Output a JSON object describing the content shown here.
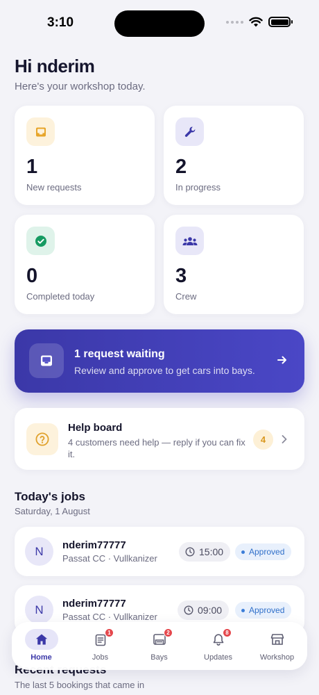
{
  "status_bar": {
    "time": "3:10"
  },
  "header": {
    "greeting": "Hi nderim",
    "subtitle": "Here's your workshop today."
  },
  "stats": [
    {
      "value": "1",
      "label": "New requests",
      "icon": "inbox-icon"
    },
    {
      "value": "2",
      "label": "In progress",
      "icon": "wrench-icon"
    },
    {
      "value": "0",
      "label": "Completed today",
      "icon": "check-circle-icon"
    },
    {
      "value": "3",
      "label": "Crew",
      "icon": "group-icon"
    }
  ],
  "banner": {
    "title": "1 request waiting",
    "text": "Review and approve to get cars into bays."
  },
  "help_board": {
    "title": "Help board",
    "text": "4 customers need help — reply if you can fix it.",
    "count": "4"
  },
  "todays_jobs": {
    "title": "Today's jobs",
    "date": "Saturday, 1 August",
    "items": [
      {
        "initial": "N",
        "name": "nderim77777",
        "car": "Passat CC · Vullkanizer",
        "time": "15:00",
        "status": "Approved"
      },
      {
        "initial": "N",
        "name": "nderim77777",
        "car": "Passat CC · Vullkanizer",
        "time": "09:00",
        "status": "Approved"
      }
    ]
  },
  "recent_requests": {
    "title": "Recent requests",
    "subtitle": "The last 5 bookings that came in"
  },
  "tabbar": [
    {
      "label": "Home",
      "active": true
    },
    {
      "label": "Jobs",
      "badge": "1"
    },
    {
      "label": "Bays",
      "badge": "2"
    },
    {
      "label": "Updates",
      "badge": "8"
    },
    {
      "label": "Workshop"
    }
  ],
  "colors": {
    "accent": "#3b38a8",
    "background": "#f3f3f8",
    "badge": "#e5484d",
    "approved": "#2f6fc9"
  }
}
